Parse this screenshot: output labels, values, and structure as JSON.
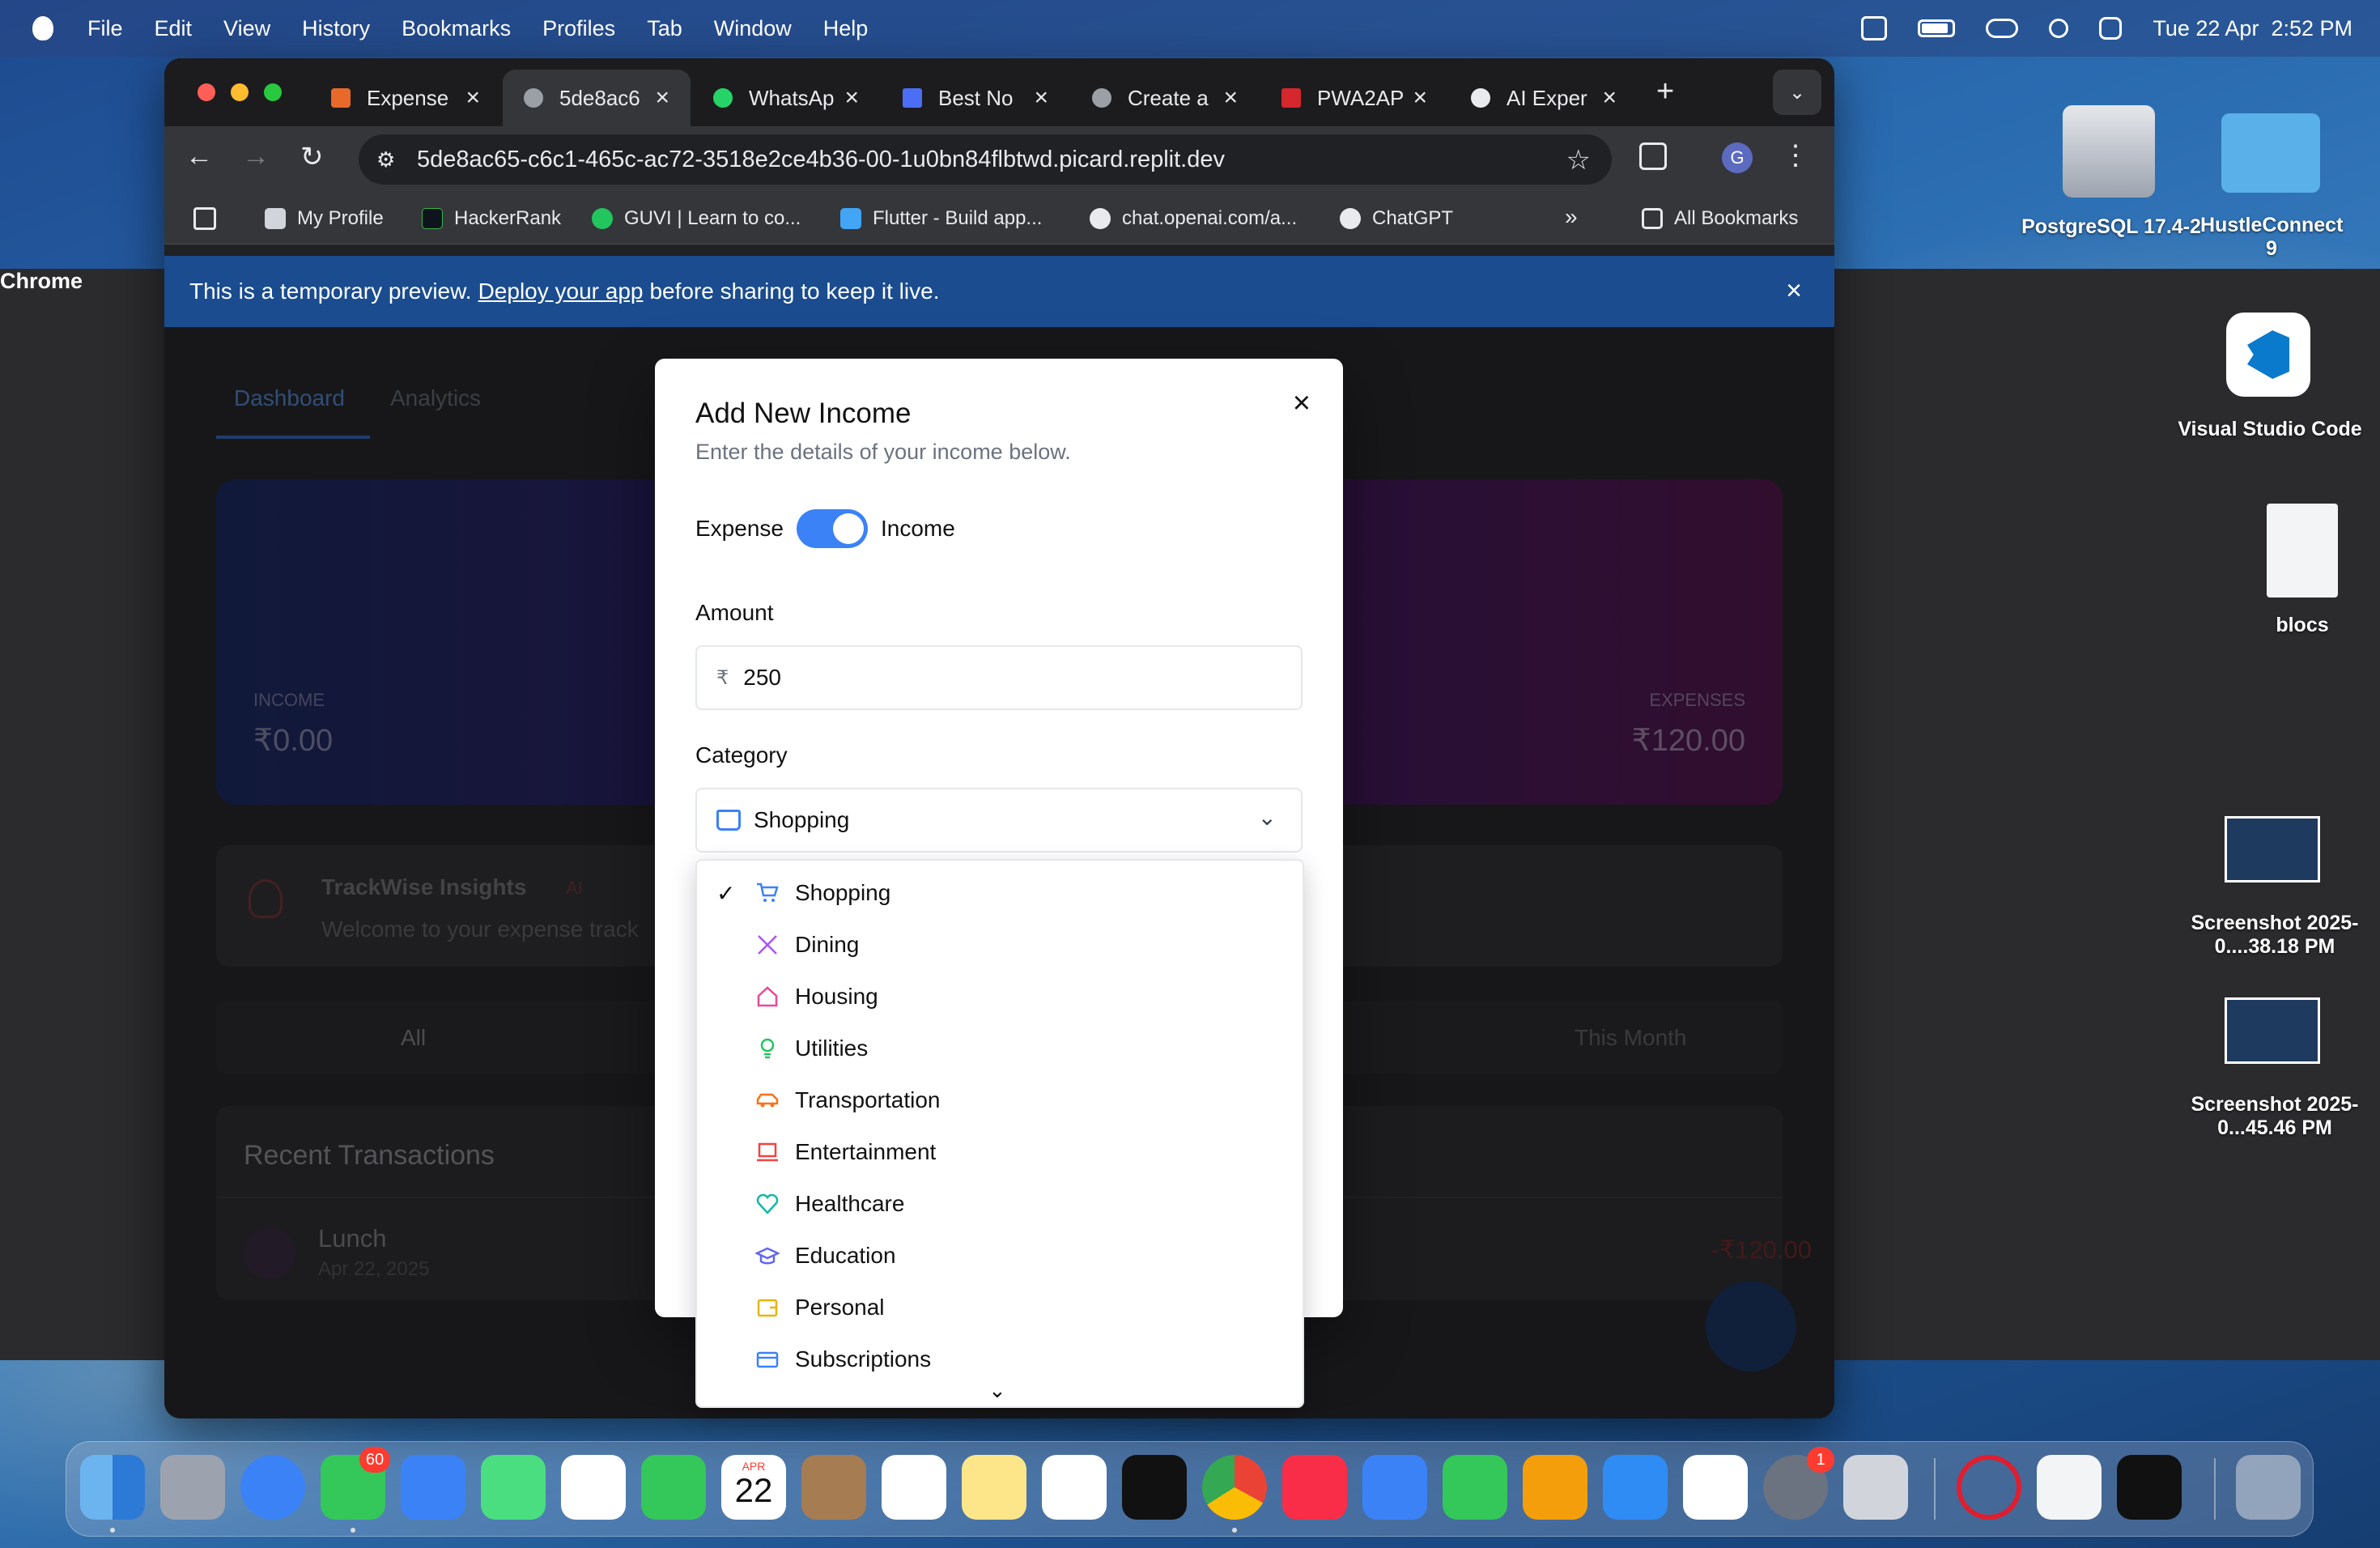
{
  "menubar": {
    "app_name": "Chrome",
    "items": [
      "File",
      "Edit",
      "View",
      "History",
      "Bookmarks",
      "Profiles",
      "Tab",
      "Window",
      "Help"
    ],
    "clock": "Tue 22 Apr  2:52 PM"
  },
  "tabs": [
    {
      "title": "Expense",
      "color": "#e8692a"
    },
    {
      "title": "5de8ac6",
      "color": "#9aa0a6"
    },
    {
      "title": "WhatsAp",
      "color": "#25d366"
    },
    {
      "title": "Best No",
      "color": "#4c6ef5"
    },
    {
      "title": "Create a",
      "color": "#9aa0a6"
    },
    {
      "title": "PWA2AP",
      "color": "#d6262e"
    },
    {
      "title": "AI Exper",
      "color": "#e8eaed"
    }
  ],
  "address": "5de8ac65-c6c1-465c-ac72-3518e2ce4b36-00-1u0bn84flbtwd.picard.replit.dev",
  "profile_initial": "G",
  "bookmarks": [
    "My Profile",
    "HackerRank",
    "GUVI | Learn to co...",
    "Flutter - Build app...",
    "chat.openai.com/a...",
    "ChatGPT",
    "All Bookmarks"
  ],
  "banner": {
    "prefix": "This is a temporary preview.",
    "link": "Deploy your app",
    "suffix": "before sharing to keep it live."
  },
  "background_app": {
    "tab_dashboard": "Dashboard",
    "tab_analytics": "Analytics",
    "income_label": "INCOME",
    "income_value": "₹0.00",
    "expenses_label": "EXPENSES",
    "expenses_value": "₹120.00",
    "insights_title": "TrackWise Insights",
    "insights_badge": "AI",
    "insights_text": "Welcome to your expense track",
    "filter_all": "All",
    "filter_month": "This Month",
    "recent_title": "Recent Transactions",
    "txn_name": "Lunch",
    "txn_date": "Apr 22, 2025",
    "txn_amount": "-₹120.00"
  },
  "modal": {
    "title": "Add New Income",
    "subtitle": "Enter the details of your income below.",
    "toggle_left": "Expense",
    "toggle_right": "Income",
    "amount_label": "Amount",
    "currency": "₹",
    "amount_value": "250",
    "category_label": "Category",
    "category_value": "Shopping"
  },
  "categories": [
    {
      "label": "Shopping",
      "icon": "cart-icon",
      "color": "#3b82f6",
      "selected": true
    },
    {
      "label": "Dining",
      "icon": "utensils-icon",
      "color": "#a855f7"
    },
    {
      "label": "Housing",
      "icon": "home-icon",
      "color": "#ec4899"
    },
    {
      "label": "Utilities",
      "icon": "lightbulb-icon",
      "color": "#22c55e"
    },
    {
      "label": "Transportation",
      "icon": "car-icon",
      "color": "#f97316"
    },
    {
      "label": "Entertainment",
      "icon": "tv-icon",
      "color": "#ef4444"
    },
    {
      "label": "Healthcare",
      "icon": "heart-icon",
      "color": "#14b8a6"
    },
    {
      "label": "Education",
      "icon": "graduation-cap-icon",
      "color": "#6366f1"
    },
    {
      "label": "Personal",
      "icon": "wallet-icon",
      "color": "#eab308"
    },
    {
      "label": "Subscriptions",
      "icon": "credit-card-icon",
      "color": "#3b82f6"
    }
  ],
  "desktop": [
    {
      "label": "PostgreSQL 17.4-2"
    },
    {
      "label": "HustleConnect 9"
    },
    {
      "label": "Visual Studio Code"
    },
    {
      "label": "blocs"
    },
    {
      "label": "Screenshot 2025-0....38.18 PM"
    },
    {
      "label": "Screenshot 2025-0...45.46 PM"
    }
  ],
  "dock": {
    "messages_badge": "60",
    "calendar_month": "APR",
    "calendar_day": "22",
    "settings_badge": "1"
  }
}
